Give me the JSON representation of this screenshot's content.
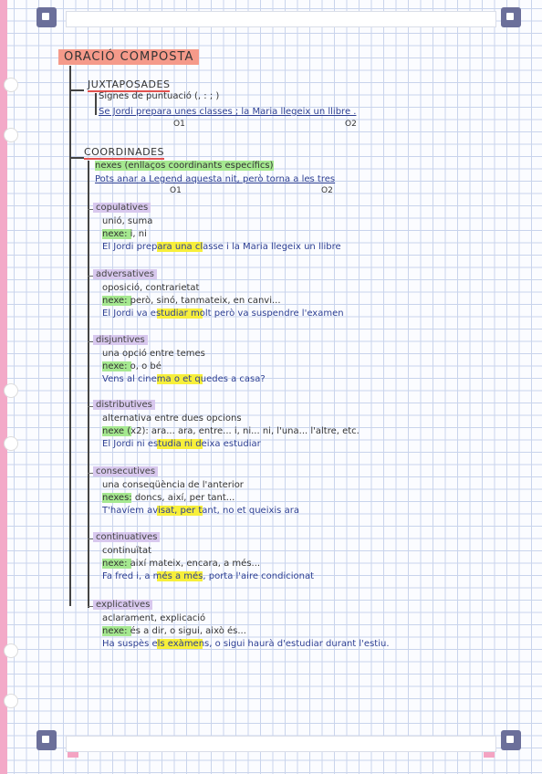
{
  "title": "ORACIÓ COMPOSTA",
  "juxtaposades": {
    "heading": "JUXTAPOSADES",
    "rule": "Signes de puntuació (, : ; )",
    "example": "Se Jordi prepara unes classes ; la Maria llegeix un llibre .",
    "o1": "O1",
    "o2": "O2"
  },
  "coordinades": {
    "heading": "COORDINADES",
    "rule": "nexes (enllaços coordinants específics)",
    "example": "Pots anar a Legend aquesta nit, però torna a les tres",
    "o1": "O1",
    "o2": "O2"
  },
  "sections": [
    {
      "label": "copulatives",
      "lines": [
        "unió, suma",
        "nexe: i, ni"
      ],
      "example": "El Jordi prepara una classe i la Maria llegeix un llibre"
    },
    {
      "label": "adversatives",
      "lines": [
        "oposició, contrarietat",
        "nexe: però, sinó, tanmateix, en canvi..."
      ],
      "example": "El Jordi va estudiar molt però va suspendre l'examen"
    },
    {
      "label": "disjuntives",
      "lines": [
        "una opció entre temes",
        "nexe: o, o bé"
      ],
      "example": "Vens al cinema o et quedes a casa?"
    },
    {
      "label": "distributives",
      "lines": [
        "alternativa entre dues opcions",
        "nexe (x2): ara... ara, entre... i, ni... ni, l'una... l'altre, etc."
      ],
      "example": "El Jordi ni estudia ni deixa estudiar"
    },
    {
      "label": "consecutives",
      "lines": [
        "una conseqüència de l'anterior",
        "nexes: doncs, així, per tant..."
      ],
      "example": "T'havíem avisat, per tant, no et queixis ara"
    },
    {
      "label": "continuatives",
      "lines": [
        "continuïtat",
        "nexe: així mateix, encara, a més..."
      ],
      "example": "Fa fred i, a més a més, porta l'aire condicionat"
    },
    {
      "label": "explicatives",
      "lines": [
        "aclarament, explicació",
        "nexe: és a dir, o sigui, això és..."
      ],
      "example": "Ha suspès els exàmens, o sigui haurà d'estudiar durant l'estiu."
    }
  ],
  "colors": {
    "title_highlight": "#f59a8a",
    "category_highlight": "#d8c8ee",
    "yellow_highlight": "#f7ef3a",
    "green_highlight": "#a5e890",
    "circle": "#d33c3c",
    "example_ink": "#2d3f93"
  }
}
